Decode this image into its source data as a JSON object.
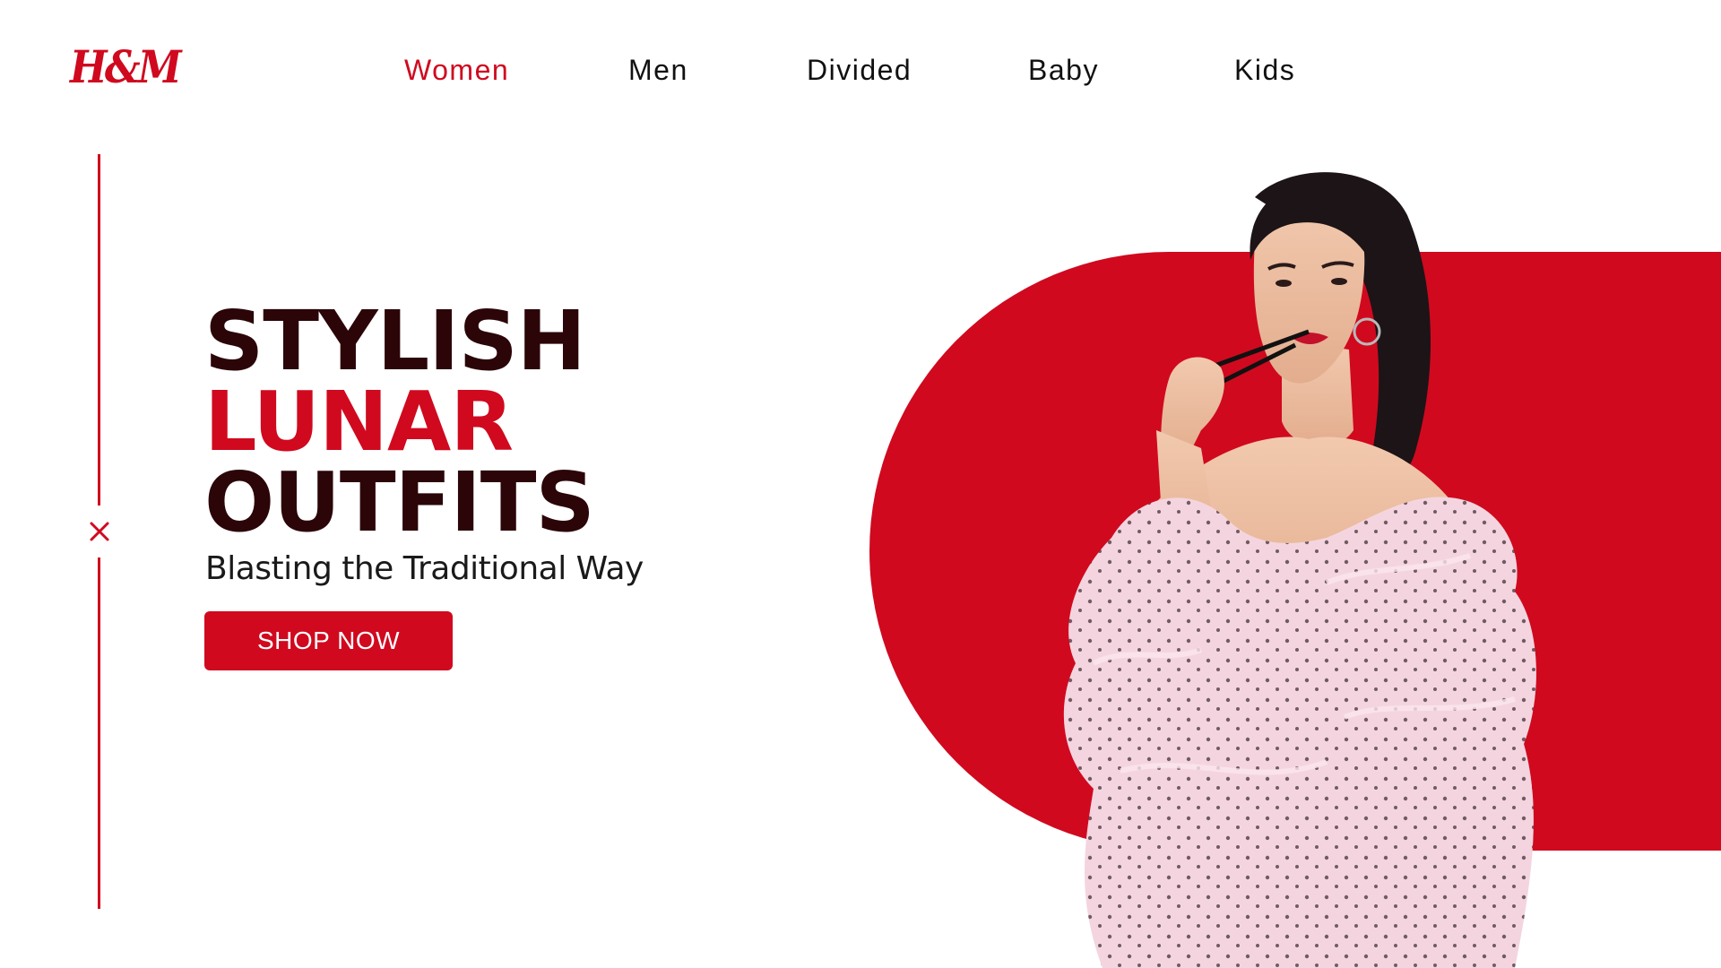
{
  "brand": {
    "logo_text": "H&M",
    "color": "#d0091f"
  },
  "nav": {
    "items": [
      {
        "label": "Women",
        "active": true
      },
      {
        "label": "Men",
        "active": false
      },
      {
        "label": "Divided",
        "active": false
      },
      {
        "label": "Baby",
        "active": false
      },
      {
        "label": "Kids",
        "active": false
      }
    ]
  },
  "hero": {
    "headline": {
      "line1": "STYLISH",
      "line2": "LUNAR",
      "line3": "OUTFITS"
    },
    "subtitle": "Blasting the Traditional Way",
    "cta_label": "SHOP NOW",
    "close_icon": "close-icon",
    "image": "model-photo"
  },
  "colors": {
    "accent": "#d0091f",
    "headline_dark": "#2b0508",
    "background": "#ffffff"
  }
}
